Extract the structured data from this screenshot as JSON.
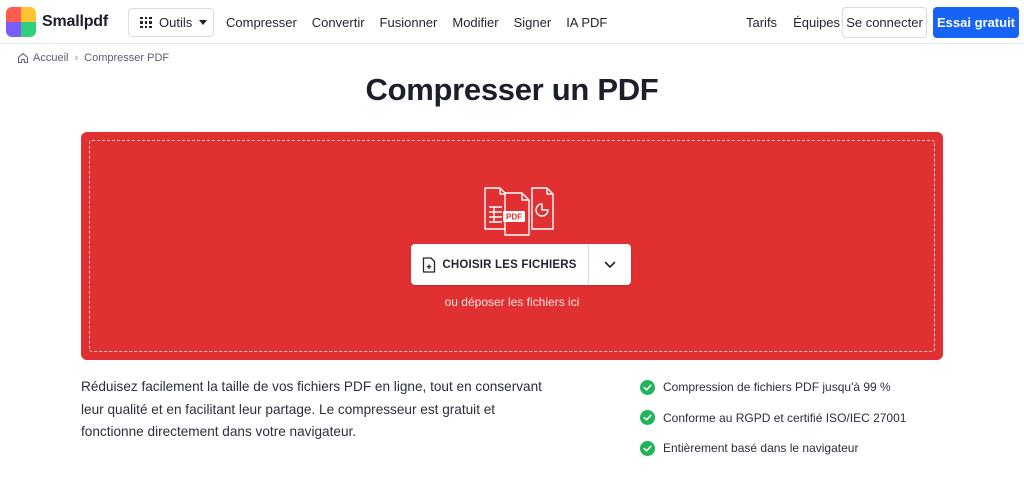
{
  "header": {
    "logo_text": "Smallpdf",
    "tools_label": "Outils",
    "nav_left": [
      "Compresser",
      "Convertir",
      "Fusionner",
      "Modifier",
      "Signer",
      "IA PDF"
    ],
    "nav_right": [
      "Tarifs",
      "Équipes"
    ],
    "login_label": "Se connecter",
    "trial_label": "Essai gratuit"
  },
  "breadcrumb": {
    "home": "Accueil",
    "current": "Compresser PDF"
  },
  "page": {
    "title": "Compresser un PDF"
  },
  "dropzone": {
    "choose_label": "CHOISIR LES FICHIERS",
    "drop_hint": "ou déposer les fichiers ici",
    "icon_badge": "PDF"
  },
  "description": "Réduisez facilement la taille de vos fichiers PDF en ligne, tout en conservant leur qualité et en facilitant leur partage. Le compresseur est gratuit et fonctionne directement dans votre navigateur.",
  "features": [
    "Compression de fichiers PDF jusqu'à 99 %",
    "Conforme au RGPD et certifié ISO/IEC 27001",
    "Entièrement basé dans le navigateur"
  ],
  "colors": {
    "brand_red": "#e03032",
    "primary_blue": "#1763f5",
    "check_green": "#20b45a"
  }
}
